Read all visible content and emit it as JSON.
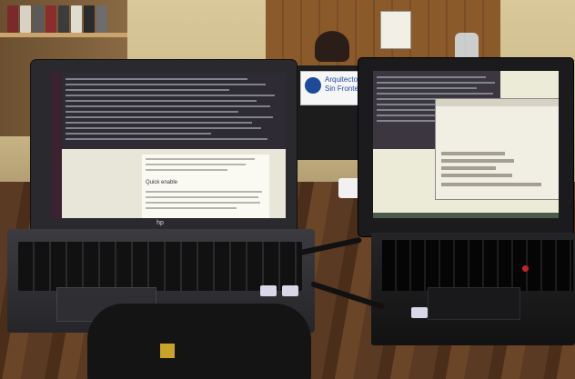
{
  "photo": {
    "subject": "Two laptops on a wooden desk",
    "background_sign": {
      "line1": "Arquitecto",
      "line2": "Sin Fronter"
    },
    "left_laptop": {
      "brand_mark": "hp",
      "doc_heading": "Quick enable"
    }
  },
  "colors": {
    "desk": "#4a2e19",
    "wall": "#d2c08f",
    "laptop_dark": "#1b1b1d",
    "sign_blue": "#1e4a9a",
    "trackpoint_red": "#c7212a"
  }
}
